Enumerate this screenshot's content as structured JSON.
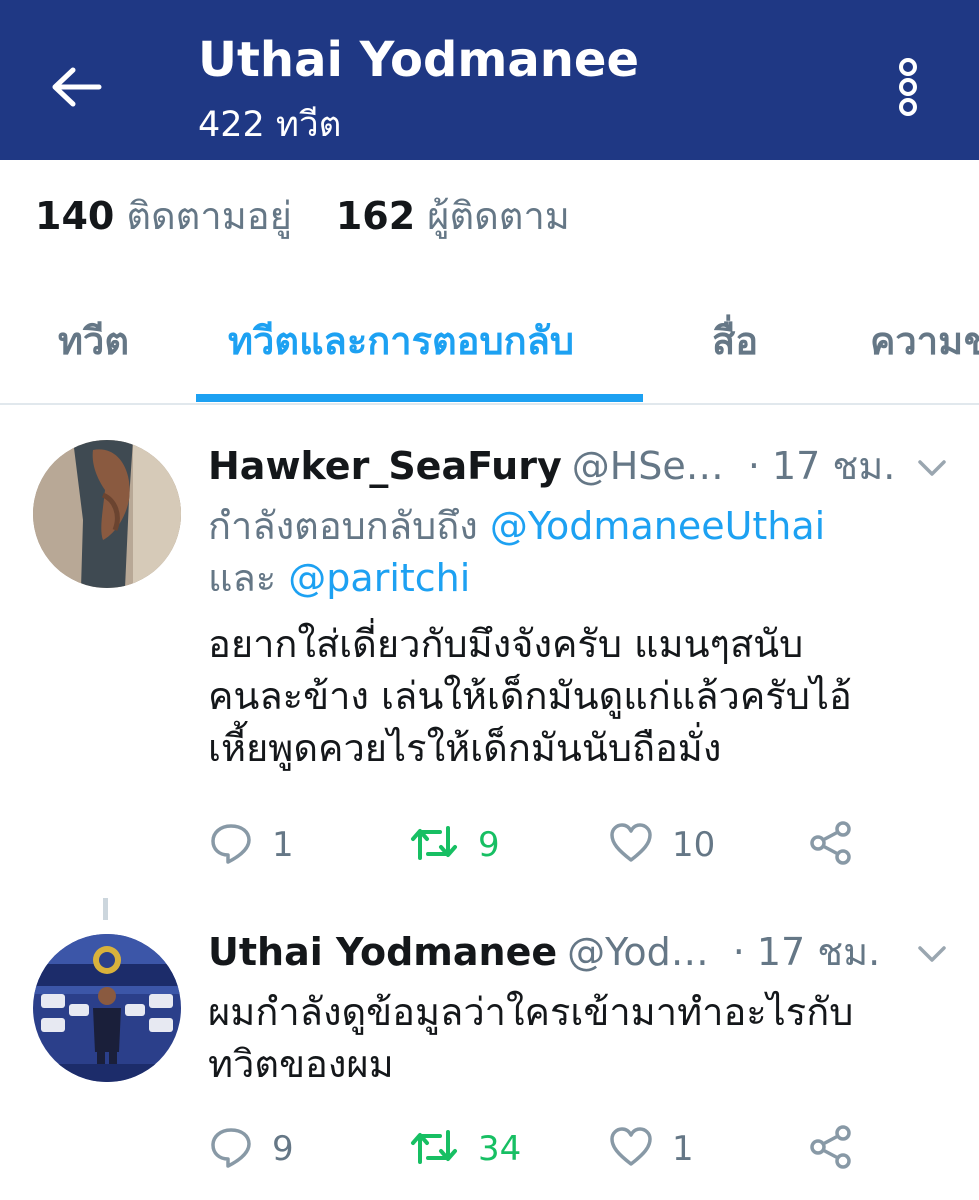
{
  "header": {
    "title": "Uthai Yodmanee",
    "subtitle": "422 ทวีต",
    "background": "#1f3884"
  },
  "stats": {
    "following_count": "140",
    "following_label": "ติดตามอยู่",
    "followers_count": "162",
    "followers_label": "ผู้ติดตาม"
  },
  "tabs": [
    {
      "label": "ทวีต",
      "active": false
    },
    {
      "label": "ทวีตและการตอบกลับ",
      "active": true
    },
    {
      "label": "สื่อ",
      "active": false
    },
    {
      "label": "ความช",
      "active": false
    }
  ],
  "tweets": [
    {
      "author_name": "Hawker_SeaFury",
      "handle": "@HSe…",
      "time": "· 17 ชม.",
      "reply_prefix": "กำลังตอบกลับถึง",
      "reply_mention_1": "@YodmaneeUthai",
      "reply_and": "และ",
      "reply_mention_2": "@paritchi",
      "text_lines": [
        "อยากใส่เดี่ยวกับมึงจังครับ แมนๆสนับ",
        "คนละข้าง เล่นให้เด็กมันดูแก่แล้วครับไอ้",
        "เหี้ยพูดควยไรให้เด็กมันนับถือมั่ง"
      ],
      "replies": "1",
      "retweets": "9",
      "likes": "10",
      "icons": [
        "reply-icon",
        "retweet-icon",
        "like-icon",
        "share-icon"
      ]
    },
    {
      "author_name": "Uthai Yodmanee",
      "handle": "@Yod…",
      "time": "· 17 ชม.",
      "text_lines": [
        "ผมกำลังดูข้อมูลว่าใครเข้ามาทำอะไรกับ",
        "ทวิตของผม"
      ],
      "replies": "9",
      "retweets": "34",
      "likes": "1",
      "icons": [
        "reply-icon",
        "retweet-icon",
        "like-icon",
        "share-icon"
      ]
    }
  ],
  "colors": {
    "accent": "#1da1f2",
    "retweet_active": "#17bf63",
    "muted": "#657786"
  }
}
